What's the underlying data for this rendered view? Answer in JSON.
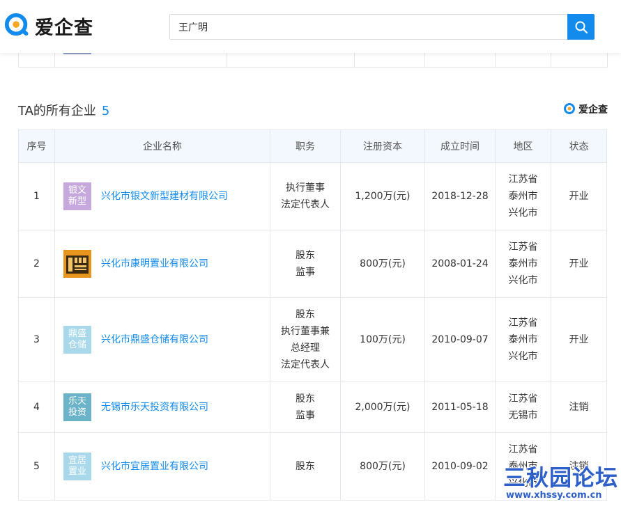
{
  "app": {
    "logo_text": "爱企查"
  },
  "search": {
    "value": "王广明"
  },
  "section": {
    "title": "TA的所有企业",
    "count": "5",
    "brand": "爱企查"
  },
  "table": {
    "headers": [
      "序号",
      "企业名称",
      "职务",
      "注册资本",
      "成立时间",
      "地区",
      "状态"
    ],
    "rows": [
      {
        "index": "1",
        "logo_text": "银文\n新型",
        "logo_color": "#c7a8dd",
        "name": "兴化市银文新型建材有限公司",
        "role": "执行董事\n法定代表人",
        "capital": "1,200万(元)",
        "date": "2018-12-28",
        "region": "江苏省\n泰州市\n兴化市",
        "status": "开业",
        "status_type": "open"
      },
      {
        "index": "2",
        "logo_text": "",
        "logo_color": "#e8951d",
        "logo_icon": "building-logo-icon",
        "name": "兴化市康明置业有限公司",
        "role": "股东\n监事",
        "capital": "800万(元)",
        "date": "2008-01-24",
        "region": "江苏省\n泰州市\n兴化市",
        "status": "开业",
        "status_type": "open"
      },
      {
        "index": "3",
        "logo_text": "鼎盛\n仓储",
        "logo_color": "#a8d8ea",
        "name": "兴化市鼎盛仓储有限公司",
        "role": "股东\n执行董事兼\n总经理\n法定代表人",
        "capital": "100万(元)",
        "date": "2010-09-07",
        "region": "江苏省\n泰州市\n兴化市",
        "status": "开业",
        "status_type": "open"
      },
      {
        "index": "4",
        "logo_text": "乐天\n投资",
        "logo_color": "#6ab3c8",
        "name": "无锡市乐天投资有限公司",
        "role": "股东\n监事",
        "capital": "2,000万(元)",
        "date": "2011-05-18",
        "region": "江苏省\n无锡市",
        "status": "注销",
        "status_type": "closed"
      },
      {
        "index": "5",
        "logo_text": "宜居\n置业",
        "logo_color": "#a8d8ea",
        "name": "兴化市宜居置业有限公司",
        "role": "股东",
        "capital": "800万(元)",
        "date": "2010-09-02",
        "region": "江苏省\n泰州市\n兴化市",
        "status": "注销",
        "status_type": "closed"
      }
    ]
  },
  "colors": {
    "accent": "#128bed",
    "header_bg": "#f2f8fe",
    "open": "#3fa93f",
    "closed": "#e25656"
  },
  "watermark": {
    "title": "三秋园论坛",
    "url": "www.xhssy.com.cn"
  }
}
